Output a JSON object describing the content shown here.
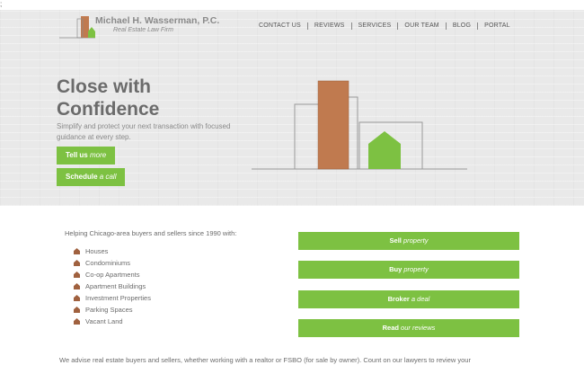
{
  "stray_char": ";",
  "brand": {
    "name": "Michael H. Wasserman, P.C.",
    "tagline": "Real Estate Law Firm"
  },
  "nav": [
    "CONTACT US",
    "REVIEWS",
    "SERVICES",
    "OUR TEAM",
    "BLOG",
    "PORTAL"
  ],
  "hero": {
    "title_line1": "Close with",
    "title_line2": "Confidence",
    "text": "Simplify and protect your next transaction with focused guidance at every step.",
    "btn1": {
      "strong": "Tell us",
      "em": " more"
    },
    "btn2": {
      "strong": "Schedule",
      "em": " a call"
    }
  },
  "intro": "Helping Chicago-area buyers and sellers since 1990 with:",
  "property_types": [
    "Houses",
    "Condominiums",
    "Co-op Apartments",
    "Apartment Buildings",
    "Investment Properties",
    "Parking Spaces",
    "Vacant Land"
  ],
  "actions": [
    {
      "strong": "Sell",
      "em": " property"
    },
    {
      "strong": "Buy",
      "em": " property"
    },
    {
      "strong": "Broker",
      "em": " a deal"
    },
    {
      "strong": "Read",
      "em": " our reviews"
    }
  ],
  "bottom_text": "We advise real estate buyers and sellers, whether working with a realtor or FSBO (for sale by owner). Count on our lawyers to review your",
  "colors": {
    "accent_green": "#7dc142",
    "brand_brown": "#c07a4f",
    "hero_bg": "#e9e9e9",
    "text_gray": "#6b6b6b"
  }
}
